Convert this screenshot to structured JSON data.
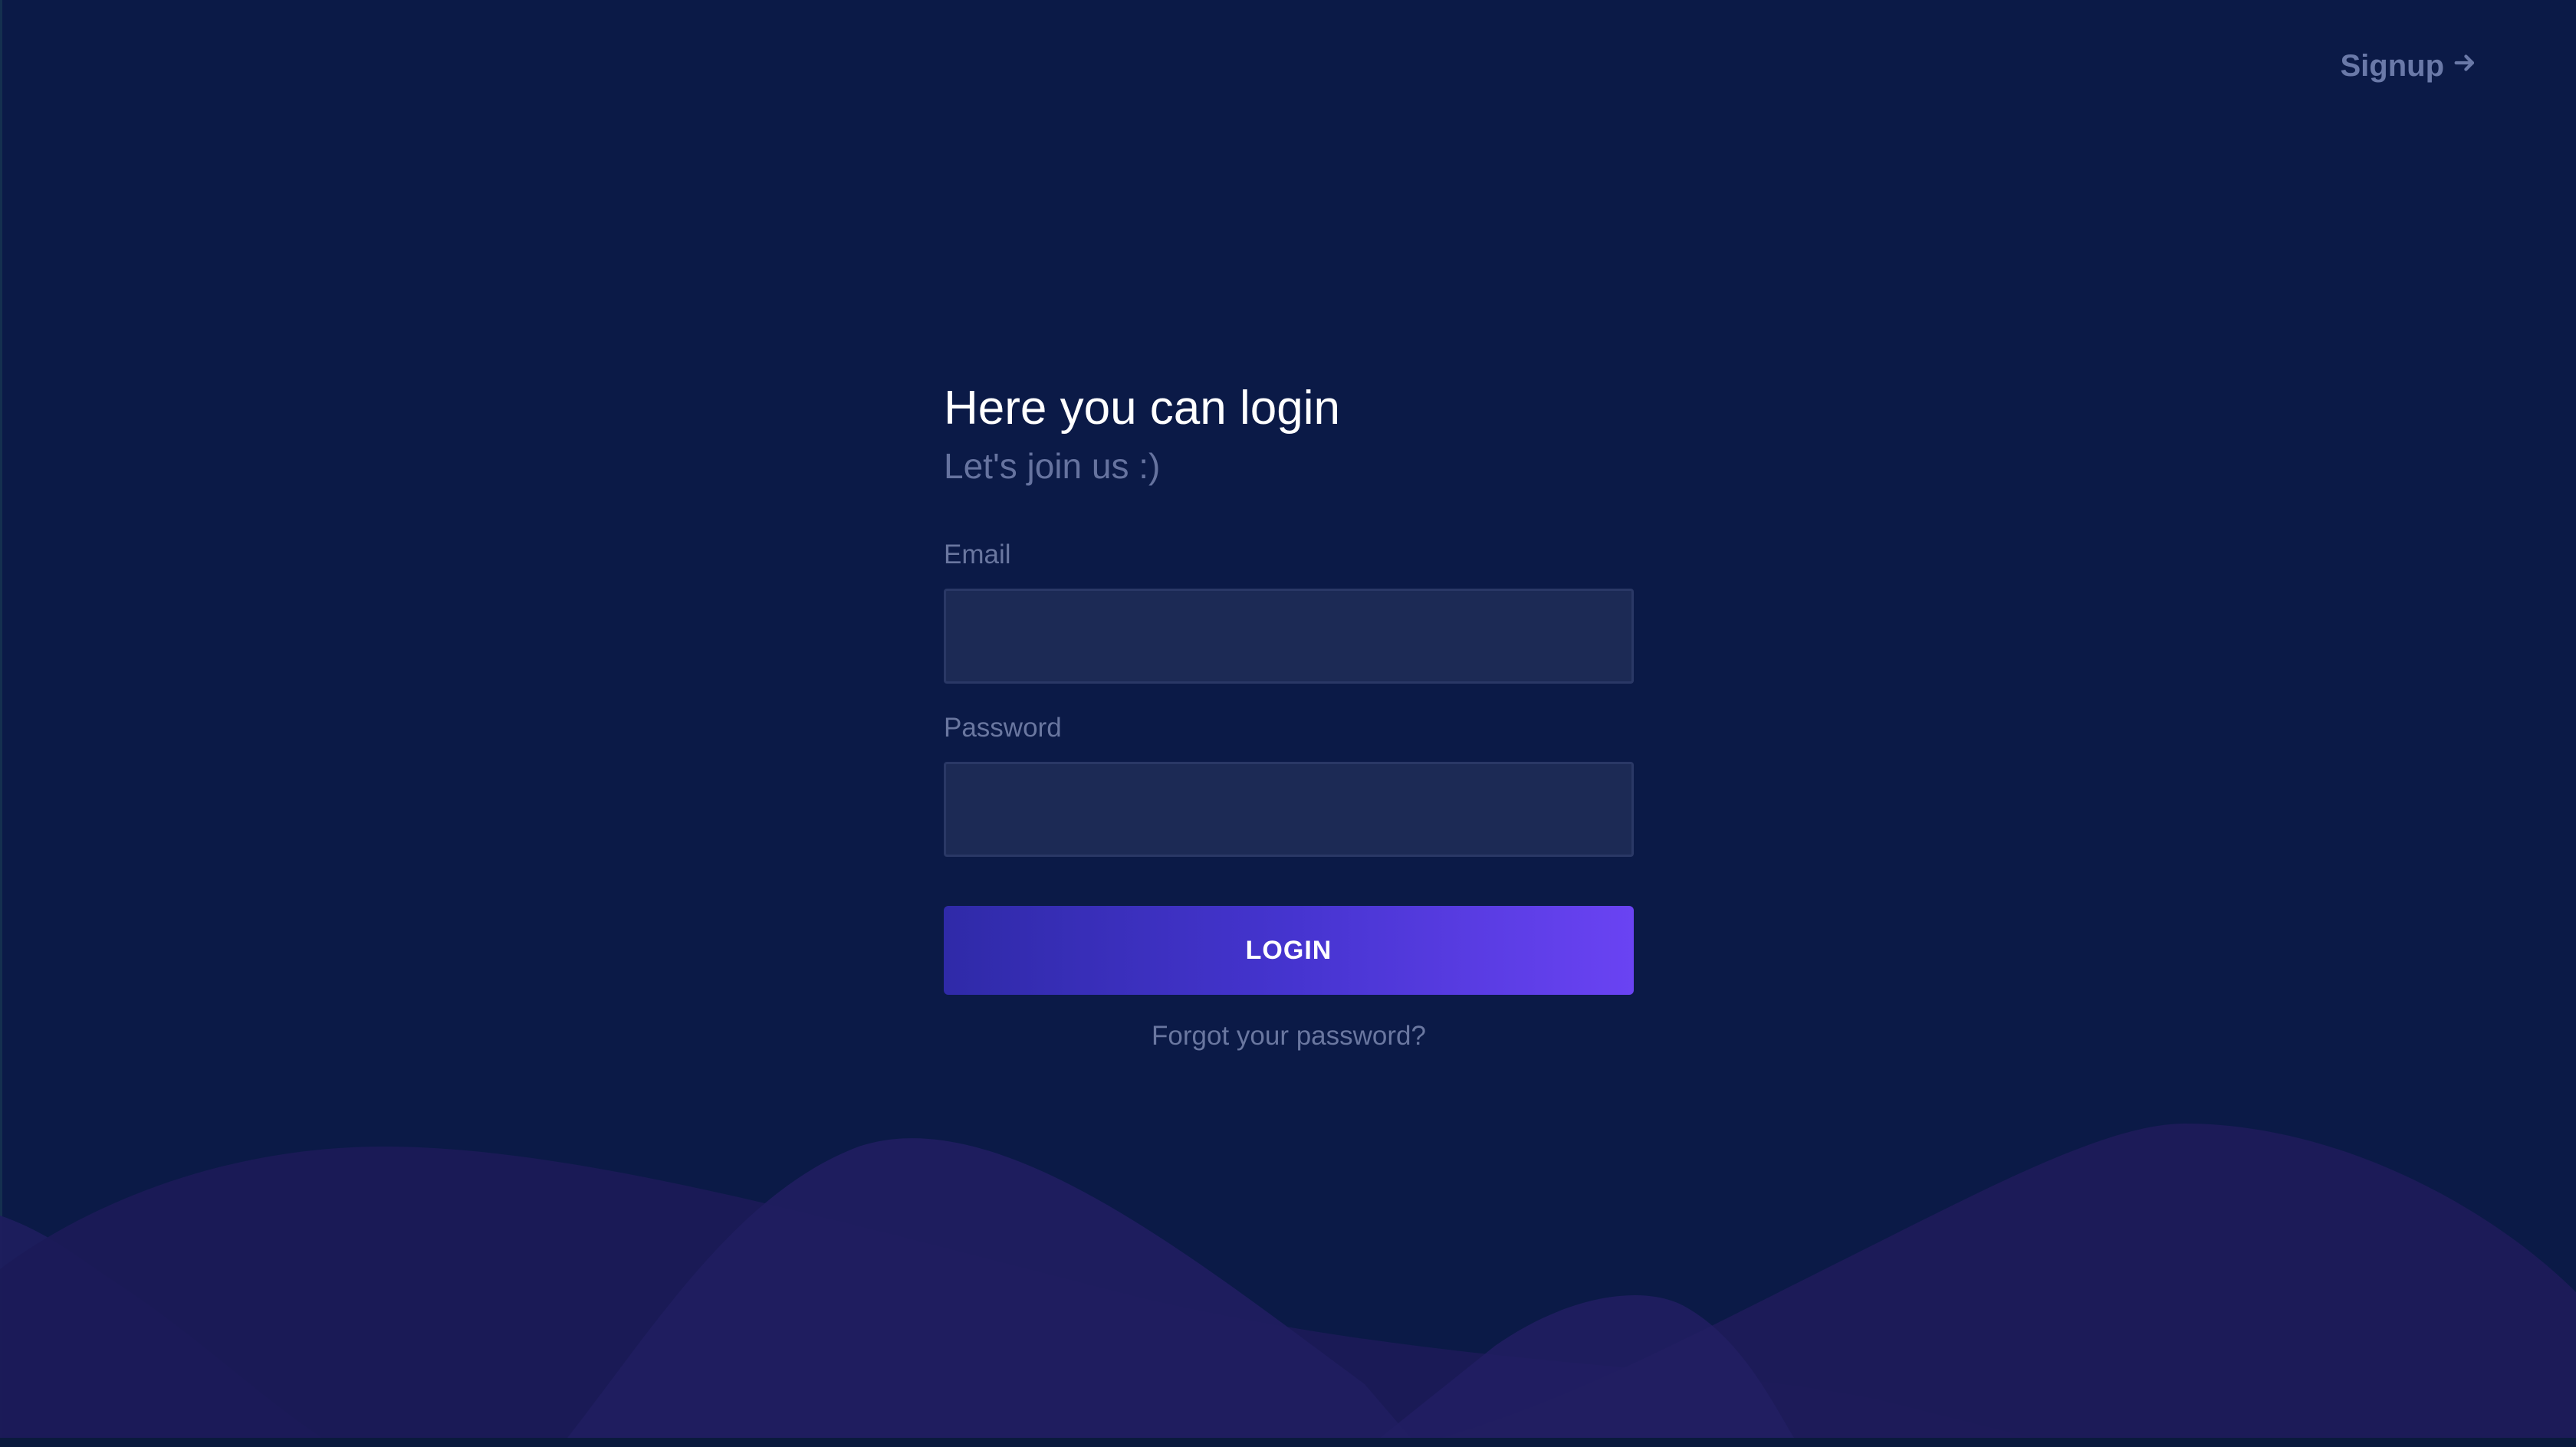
{
  "header": {
    "signup_label": "Signup",
    "signup_icon": "arrow-right-icon"
  },
  "login": {
    "title": "Here you can login",
    "subtitle": "Let's join us :)",
    "email_label": "Email",
    "email_value": "",
    "password_label": "Password",
    "password_value": "",
    "submit_label": "LOGIN",
    "forgot_label": "Forgot your password?"
  },
  "colors": {
    "background": "#0b1a47",
    "input_background": "#1c2a55",
    "button_gradient_start": "#2f2aa8",
    "button_gradient_end": "#6a43f3",
    "muted_text": "#6a77a0",
    "wave": "#1f1d5c"
  }
}
